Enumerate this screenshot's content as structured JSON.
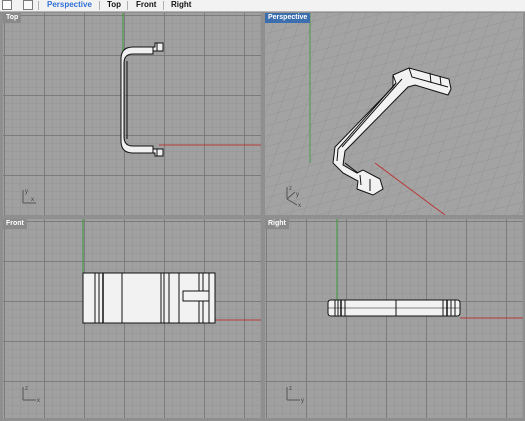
{
  "tabbar": {
    "tabs": [
      {
        "label": "Perspective",
        "active": true
      },
      {
        "label": "Top",
        "active": false
      },
      {
        "label": "Front",
        "active": false
      },
      {
        "label": "Right",
        "active": false
      }
    ]
  },
  "viewports": {
    "top": {
      "label": "Top",
      "active": false,
      "axes": {
        "h": "x",
        "v": "y"
      }
    },
    "perspective": {
      "label": "Perspective",
      "active": true,
      "axes": {
        "h": "x",
        "v": "y",
        "up": "z"
      }
    },
    "front": {
      "label": "Front",
      "active": false,
      "axes": {
        "h": "x",
        "v": "z"
      }
    },
    "right": {
      "label": "Right",
      "active": false,
      "axes": {
        "h": "y",
        "v": "z"
      }
    }
  },
  "colors": {
    "accent": "#2f6fd6",
    "active_viewport_label": "#3d6fae",
    "x_axis": "#b83a3a",
    "y_axis": "#3a9a3a",
    "grid_background": "#a0a0a0",
    "model_outline": "#111111",
    "model_fill": "#f2f2f2"
  }
}
